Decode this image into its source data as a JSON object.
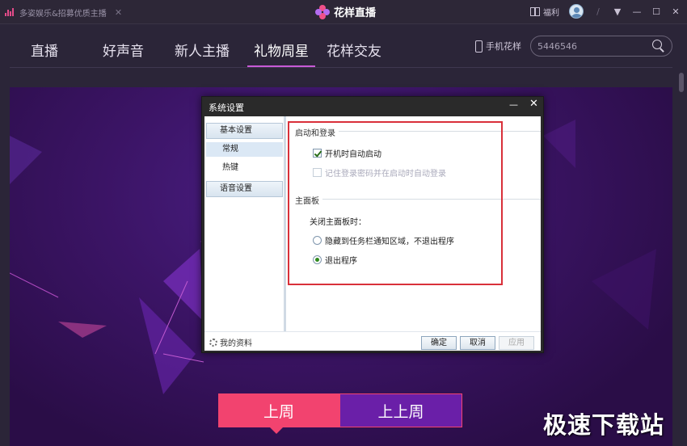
{
  "titlebar": {
    "tab_label": "多姿娱乐&招募优质主播",
    "brand_name": "花样直播",
    "welfare_label": "福利"
  },
  "nav": {
    "items": [
      "直播",
      "好声音",
      "新人主播",
      "礼物周星",
      "花样交友"
    ],
    "active_index": 3,
    "phone_label": "手机花样",
    "search_value": "5446546"
  },
  "week_tabs": {
    "current": "上周",
    "previous": "上上周"
  },
  "dialog": {
    "title": "系统设置",
    "categories": {
      "basic": "基本设置",
      "general": "常规",
      "hotkey": "热键",
      "voice": "语音设置"
    },
    "sections": {
      "startup_title": "启动和登录",
      "auto_start": "开机时自动启动",
      "auto_login": "记住登录密码并在启动时自动登录",
      "panel_title": "主面板",
      "close_label": "关闭主面板时：",
      "hide_tray": "隐藏到任务栏通知区域，不退出程序",
      "exit_program": "退出程序"
    },
    "state": {
      "auto_start_checked": true,
      "auto_login_checked": false,
      "close_action": "exit"
    },
    "footer": {
      "profile": "我的资料",
      "ok": "确定",
      "cancel": "取消",
      "apply": "应用"
    }
  },
  "watermark": "极速下载站",
  "colors": {
    "accent_pink": "#f2436f",
    "accent_purple": "#6a1fa8",
    "nav_underline": "#c85ad6",
    "highlight_red": "#d9303a"
  }
}
